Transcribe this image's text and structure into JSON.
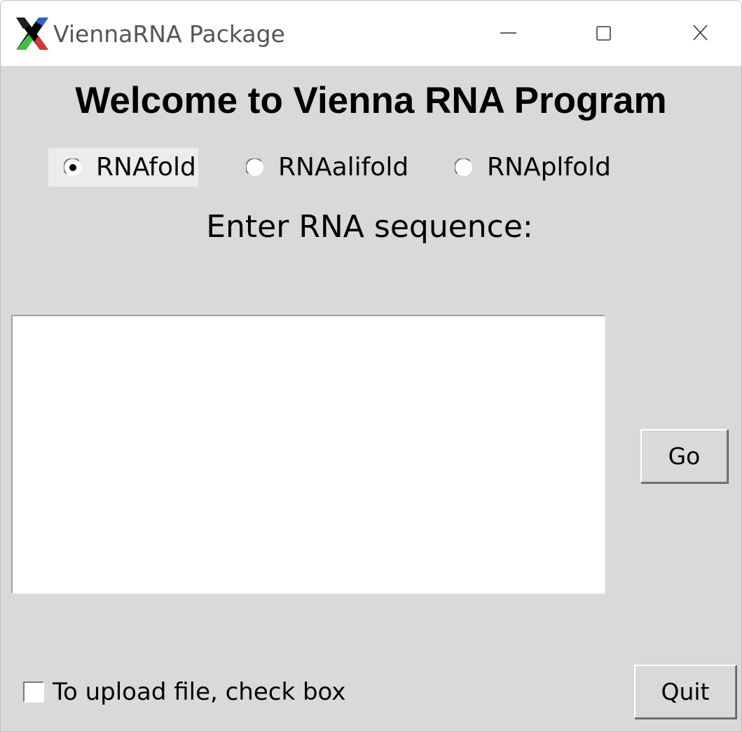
{
  "window": {
    "title": "ViennaRNA Package",
    "controls": {
      "minimize_icon": "minimize-icon",
      "maximize_icon": "maximize-icon",
      "close_icon": "close-icon"
    }
  },
  "main": {
    "heading": "Welcome to Vienna RNA Program",
    "programs": [
      {
        "label": "RNAfold",
        "selected": true
      },
      {
        "label": "RNAalifold",
        "selected": false
      },
      {
        "label": "RNAplfold",
        "selected": false
      }
    ],
    "prompt": "Enter RNA sequence:",
    "sequence_value": "",
    "go_label": "Go",
    "upload_checkbox": {
      "label": "To upload file, check box",
      "checked": false
    },
    "quit_label": "Quit"
  },
  "colors": {
    "window_bg": "#d9d9d9",
    "titlebar_bg": "#ffffff",
    "input_bg": "#ffffff"
  }
}
